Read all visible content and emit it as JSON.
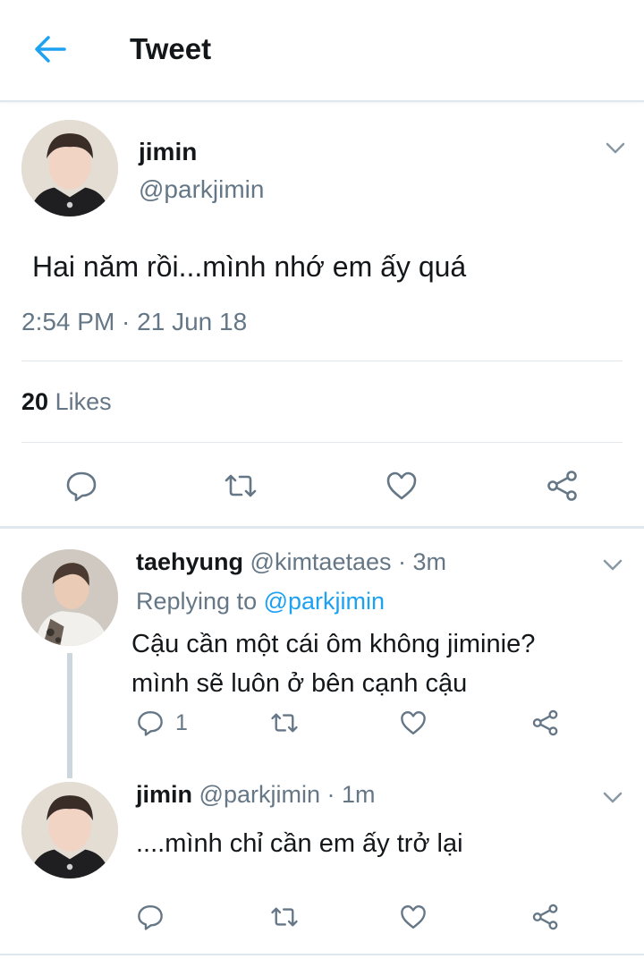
{
  "header": {
    "title": "Tweet",
    "back_icon": "back-arrow-icon"
  },
  "main_tweet": {
    "author_name": "jimin",
    "author_handle": "@parkjimin",
    "text": "Hai năm rồi...mình nhớ em ấy quá",
    "timestamp": "2:54 PM · 21 Jun 18",
    "likes_count": "20",
    "likes_label": "Likes"
  },
  "replies": [
    {
      "author_name": "taehyung",
      "author_handle": "@kimtaetaes",
      "time": "· 3m",
      "replying_label": "Replying to",
      "replying_handle": "@parkjimin",
      "text_line1": "Cậu cần một cái ôm không jiminie?",
      "text_line2": "mình sẽ luôn ở bên cạnh cậu",
      "reply_count": "1"
    },
    {
      "author_name": "jimin",
      "author_handle": "@parkjimin",
      "time": "· 1m",
      "text": "....mình chỉ cần em ấy trở lại"
    }
  ],
  "colors": {
    "accent": "#1da1f2",
    "muted": "#657786",
    "divider": "#e1e8ed",
    "icon": "#657786"
  }
}
